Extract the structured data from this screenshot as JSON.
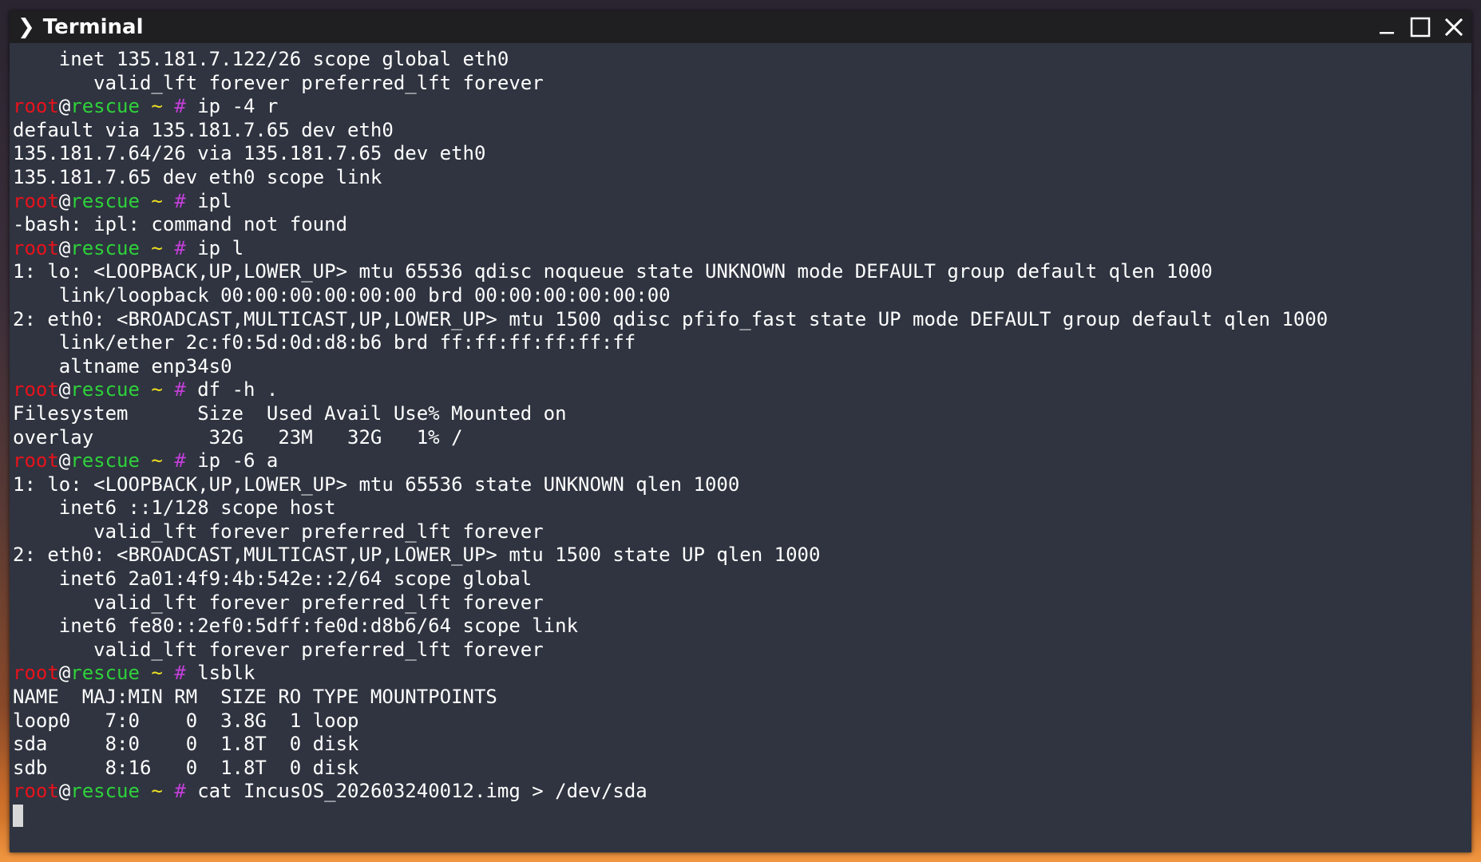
{
  "window": {
    "title": "Terminal",
    "app_icon": "❯"
  },
  "controls": {
    "minimize_icon": "minimize-icon",
    "maximize_icon": "maximize-icon",
    "close_icon": "close-icon"
  },
  "prompt": {
    "user": "root",
    "at": "@",
    "host": "rescue",
    "path": "~",
    "symbol": "#"
  },
  "lines": [
    {
      "type": "output",
      "text": "    inet 135.181.7.122/26 scope global eth0"
    },
    {
      "type": "output",
      "text": "       valid_lft forever preferred_lft forever"
    },
    {
      "type": "prompt",
      "text": "ip -4 r"
    },
    {
      "type": "output",
      "text": "default via 135.181.7.65 dev eth0"
    },
    {
      "type": "output",
      "text": "135.181.7.64/26 via 135.181.7.65 dev eth0"
    },
    {
      "type": "output",
      "text": "135.181.7.65 dev eth0 scope link"
    },
    {
      "type": "prompt",
      "text": "ipl"
    },
    {
      "type": "output",
      "text": "-bash: ipl: command not found"
    },
    {
      "type": "prompt",
      "text": "ip l"
    },
    {
      "type": "output",
      "text": "1: lo: <LOOPBACK,UP,LOWER_UP> mtu 65536 qdisc noqueue state UNKNOWN mode DEFAULT group default qlen 1000"
    },
    {
      "type": "output",
      "text": "    link/loopback 00:00:00:00:00:00 brd 00:00:00:00:00:00"
    },
    {
      "type": "output",
      "text": "2: eth0: <BROADCAST,MULTICAST,UP,LOWER_UP> mtu 1500 qdisc pfifo_fast state UP mode DEFAULT group default qlen 1000"
    },
    {
      "type": "output",
      "text": "    link/ether 2c:f0:5d:0d:d8:b6 brd ff:ff:ff:ff:ff:ff"
    },
    {
      "type": "output",
      "text": "    altname enp34s0"
    },
    {
      "type": "prompt",
      "text": "df -h ."
    },
    {
      "type": "output",
      "text": "Filesystem      Size  Used Avail Use% Mounted on"
    },
    {
      "type": "output",
      "text": "overlay          32G   23M   32G   1% /"
    },
    {
      "type": "prompt",
      "text": "ip -6 a"
    },
    {
      "type": "output",
      "text": "1: lo: <LOOPBACK,UP,LOWER_UP> mtu 65536 state UNKNOWN qlen 1000"
    },
    {
      "type": "output",
      "text": "    inet6 ::1/128 scope host"
    },
    {
      "type": "output",
      "text": "       valid_lft forever preferred_lft forever"
    },
    {
      "type": "output",
      "text": "2: eth0: <BROADCAST,MULTICAST,UP,LOWER_UP> mtu 1500 state UP qlen 1000"
    },
    {
      "type": "output",
      "text": "    inet6 2a01:4f9:4b:542e::2/64 scope global"
    },
    {
      "type": "output",
      "text": "       valid_lft forever preferred_lft forever"
    },
    {
      "type": "output",
      "text": "    inet6 fe80::2ef0:5dff:fe0d:d8b6/64 scope link"
    },
    {
      "type": "output",
      "text": "       valid_lft forever preferred_lft forever"
    },
    {
      "type": "prompt",
      "text": "lsblk"
    },
    {
      "type": "output",
      "text": "NAME  MAJ:MIN RM  SIZE RO TYPE MOUNTPOINTS"
    },
    {
      "type": "output",
      "text": "loop0   7:0    0  3.8G  1 loop"
    },
    {
      "type": "output",
      "text": "sda     8:0    0  1.8T  0 disk"
    },
    {
      "type": "output",
      "text": "sdb     8:16   0  1.8T  0 disk"
    },
    {
      "type": "prompt",
      "text": "cat IncusOS_202603240012.img > /dev/sda"
    },
    {
      "type": "cursor",
      "text": ""
    }
  ]
}
